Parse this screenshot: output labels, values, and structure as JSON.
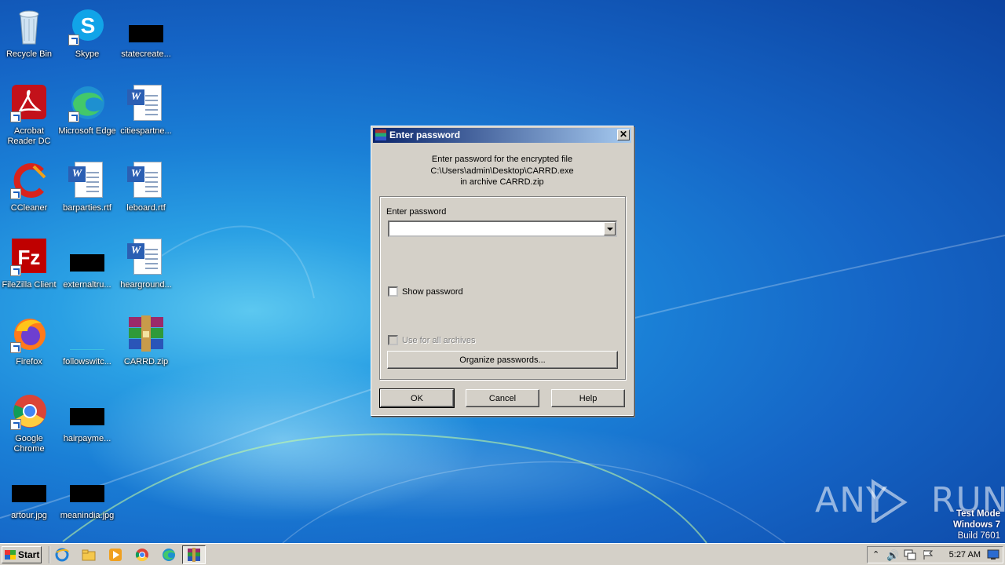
{
  "desktop": {
    "icons": [
      {
        "label": "Recycle Bin",
        "icon": "recycle-bin-icon"
      },
      {
        "label": "Skype",
        "icon": "skype-icon"
      },
      {
        "label": "statecreate...",
        "icon": "redacted-file-icon"
      },
      {
        "label": "Acrobat Reader DC",
        "icon": "acrobat-reader-icon"
      },
      {
        "label": "Microsoft Edge",
        "icon": "edge-icon"
      },
      {
        "label": "citiespartne...",
        "icon": "word-document-icon"
      },
      {
        "label": "CCleaner",
        "icon": "ccleaner-icon"
      },
      {
        "label": "barparties.rtf",
        "icon": "word-document-icon"
      },
      {
        "label": "leboard.rtf",
        "icon": "word-document-icon"
      },
      {
        "label": "FileZilla Client",
        "icon": "filezilla-icon"
      },
      {
        "label": "externaltru...",
        "icon": "redacted-file-icon"
      },
      {
        "label": "hearground...",
        "icon": "word-document-icon"
      },
      {
        "label": "Firefox",
        "icon": "firefox-icon"
      },
      {
        "label": "followswitc...",
        "icon": "blank-file-icon"
      },
      {
        "label": "CARRD.zip",
        "icon": "winrar-archive-icon"
      },
      {
        "label": "Google Chrome",
        "icon": "chrome-icon"
      },
      {
        "label": "hairpayme...",
        "icon": "redacted-file-icon"
      },
      {
        "label": "artour.jpg",
        "icon": "redacted-file-icon"
      },
      {
        "label": "meanindia.jpg",
        "icon": "redacted-file-icon"
      }
    ]
  },
  "dialog": {
    "title": "Enter password",
    "message_line1": "Enter password for the encrypted file",
    "message_line2": "C:\\Users\\admin\\Desktop\\CARRD.exe",
    "message_line3": "in archive CARRD.zip",
    "password_label": "Enter password",
    "password_value": "",
    "show_password_label": "Show password",
    "show_password_checked": false,
    "use_for_all_label": "Use for all archives",
    "use_for_all_checked": false,
    "organize_label": "Organize passwords...",
    "ok_label": "OK",
    "cancel_label": "Cancel",
    "help_label": "Help",
    "close_glyph": "✕"
  },
  "watermark": {
    "brand": "ANY RUN",
    "line1": "Test Mode",
    "line2": "Windows 7",
    "line3": "Build 7601"
  },
  "taskbar": {
    "start_label": "Start",
    "quick_launch": [
      "internet-explorer-icon",
      "file-explorer-icon",
      "media-player-icon",
      "chrome-icon",
      "edge-icon",
      "winrar-icon"
    ],
    "tray_icons": [
      "show-hidden-icons-chevron",
      "volume-icon",
      "network-icon",
      "action-center-flag-icon"
    ],
    "clock": "5:27 AM",
    "show_desktop_icon": "show-desktop-icon"
  }
}
